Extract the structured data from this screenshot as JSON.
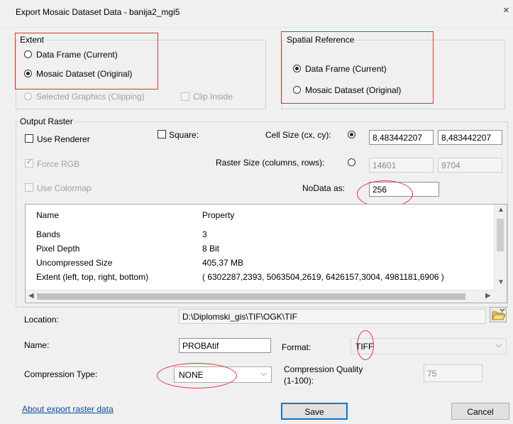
{
  "dialog": {
    "title": "Export Mosaic Dataset Data - banija2_mgi5",
    "close_label": "×"
  },
  "extent": {
    "legend": "Extent",
    "options": [
      "Data Frame (Current)",
      "Mosaic Dataset (Original)",
      "Selected Graphics (Clipping)"
    ],
    "selected": "Mosaic Dataset (Original)",
    "clip_inside_label": "Clip Inside"
  },
  "spatial_reference": {
    "legend": "Spatial Reference",
    "options": [
      "Data Frame (Current)",
      "Mosaic Dataset (Original)"
    ],
    "selected": "Data Frame (Current)"
  },
  "output_raster": {
    "legend": "Output Raster",
    "use_renderer_label": "Use Renderer",
    "square_label": "Square:",
    "force_rgb_label": "Force RGB",
    "use_colormap_label": "Use Colormap",
    "cell_size_label": "Cell Size (cx, cy):",
    "cell_size_cx": "8,483442207",
    "cell_size_cy": "8,483442207",
    "raster_size_label": "Raster Size (columns, rows):",
    "raster_columns": "14601",
    "raster_rows": "9704",
    "nodata_label": "NoData as:",
    "nodata_value": "256"
  },
  "properties": {
    "headers": [
      "Name",
      "Property"
    ],
    "rows": [
      {
        "name": "Bands",
        "value": "3"
      },
      {
        "name": "Pixel Depth",
        "value": "8 Bit"
      },
      {
        "name": "Uncompressed Size",
        "value": "405,37 MB"
      },
      {
        "name": "Extent (left, top, right, bottom)",
        "value": "( 6302287,2393, 5063504,2619, 6426157,3004, 4981181,6906 )"
      }
    ]
  },
  "location": {
    "label": "Location:",
    "value": "D:\\Diplomski_gis\\TIF\\OGK\\TIF"
  },
  "name": {
    "label": "Name:",
    "value": "PROBAtif"
  },
  "format": {
    "label": "Format:",
    "value": "TIFF"
  },
  "compression": {
    "type_label": "Compression Type:",
    "type_value": "NONE",
    "quality_label_line1": "Compression Quality",
    "quality_label_line2": "(1-100):",
    "quality_value": "75"
  },
  "footer": {
    "about_link": "About export raster data",
    "save_label": "Save",
    "cancel_label": "Cancel"
  },
  "colors": {
    "annotation_red": "#e1343b",
    "link_blue": "#0b4ca0",
    "default_button_border": "#0078d7"
  }
}
